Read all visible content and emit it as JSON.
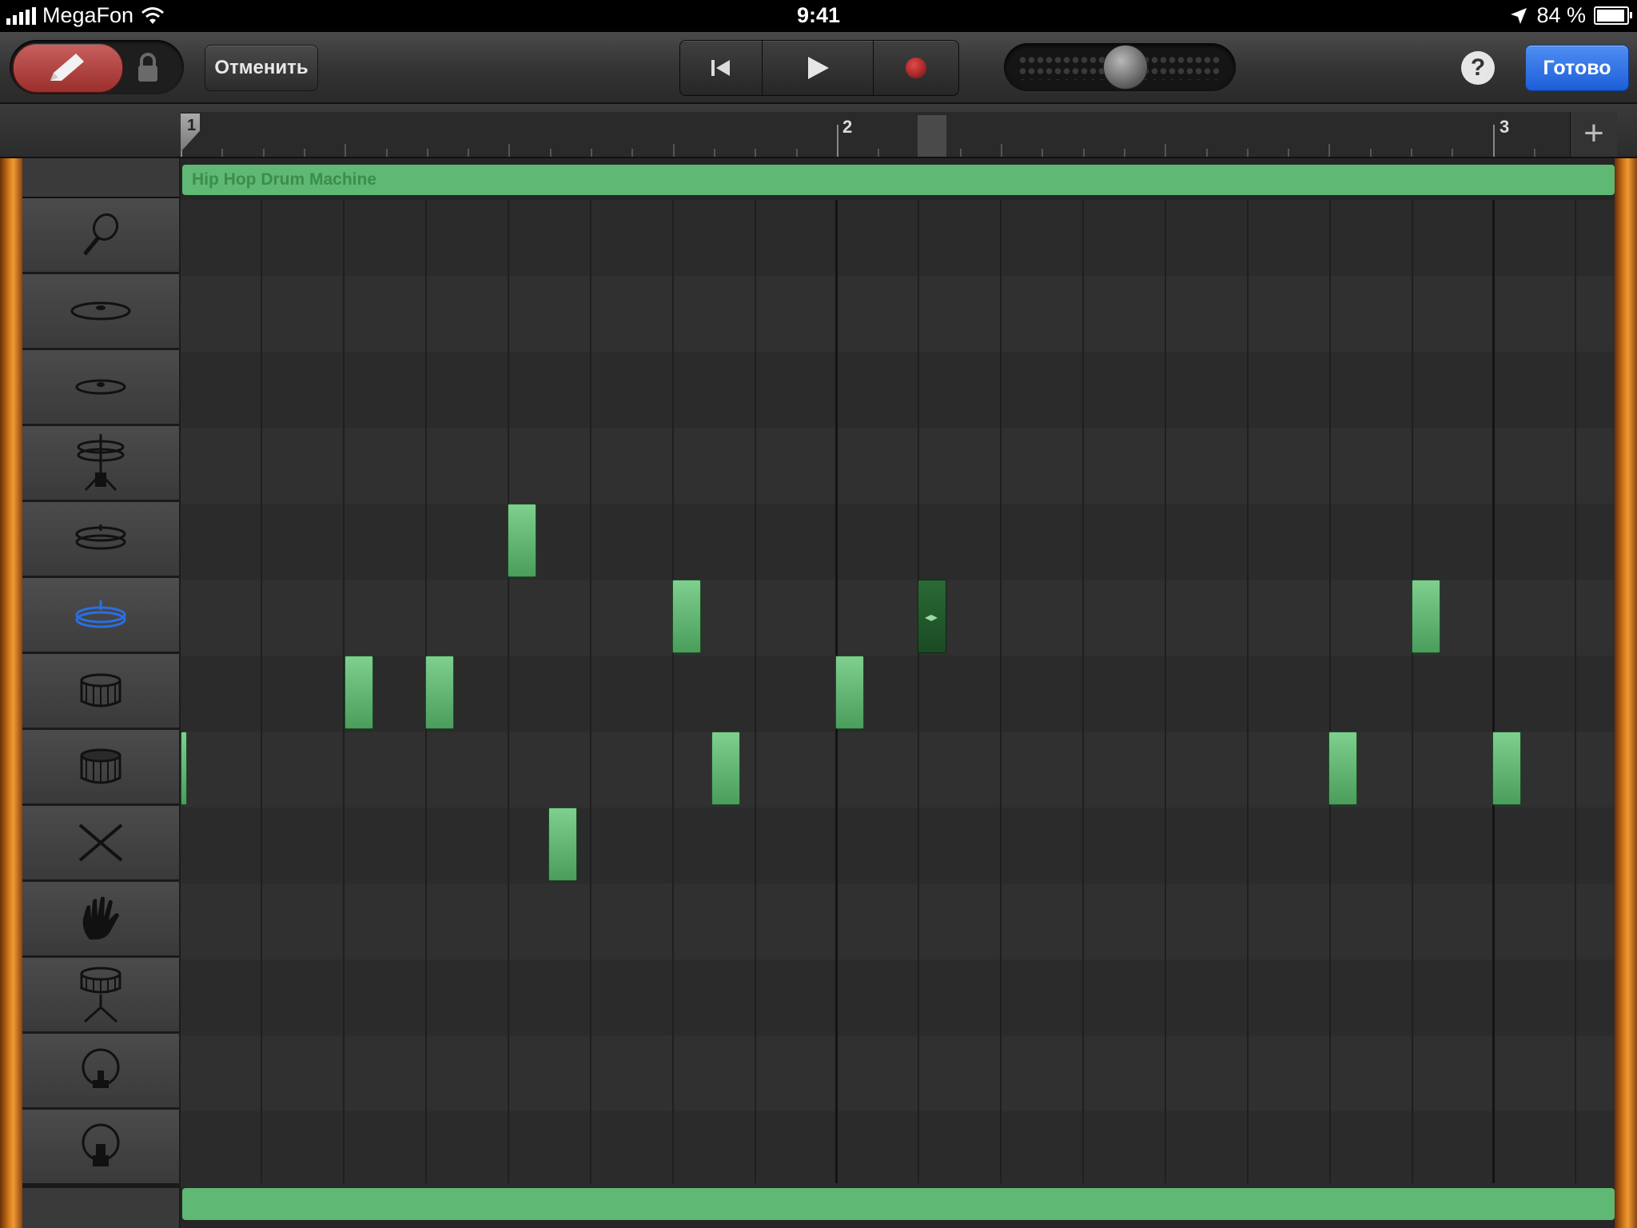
{
  "status_bar": {
    "carrier": "MegaFon",
    "time": "9:41",
    "battery": "84 %",
    "battery_level": 0.84
  },
  "toolbar": {
    "undo_label": "Отменить",
    "help_label": "?",
    "done_label": "Готово"
  },
  "ruler": {
    "bars": [
      "1",
      "2",
      "3"
    ],
    "add_label": "+"
  },
  "region": {
    "name": "Hip Hop Drum Machine"
  },
  "instruments": [
    {
      "icon": "maracas-icon"
    },
    {
      "icon": "crash-cymbal-icon"
    },
    {
      "icon": "ride-cymbal-icon"
    },
    {
      "icon": "hihat-open-icon"
    },
    {
      "icon": "hihat-closed-icon"
    },
    {
      "icon": "hihat-pedal-icon",
      "selected": true
    },
    {
      "icon": "snare-drum-icon"
    },
    {
      "icon": "snare-drum-alt-icon"
    },
    {
      "icon": "sticks-icon"
    },
    {
      "icon": "clap-icon"
    },
    {
      "icon": "tom-stand-icon"
    },
    {
      "icon": "kick-drum-icon"
    },
    {
      "icon": "kick-drum-alt-icon"
    }
  ],
  "colors": {
    "region_green": "#5fb873",
    "accent_blue": "#1c5ed8",
    "record_red": "#c9605d"
  }
}
